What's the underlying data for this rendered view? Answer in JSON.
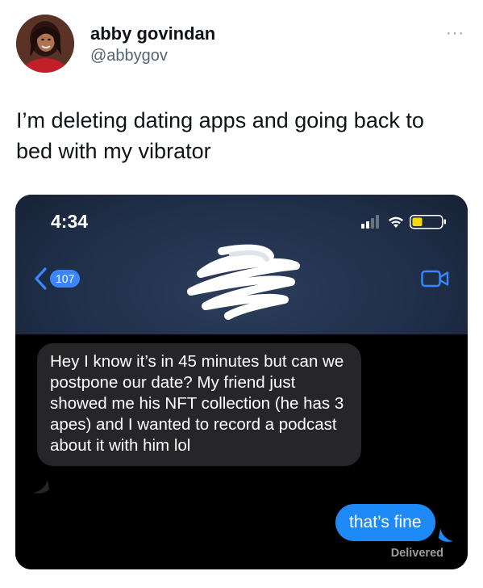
{
  "tweet": {
    "display_name": "abby govindan",
    "handle": "@abbygov",
    "more_label": "···",
    "text": "I’m deleting dating apps and going back to bed with my vibrator"
  },
  "screenshot": {
    "status_bar": {
      "time": "4:34"
    },
    "nav": {
      "unread_count": "107"
    },
    "messages": {
      "received": "Hey I know it’s in 45 minutes but can we postpone our date? My friend just showed me his NFT collection (he has 3 apes) and I wanted to record a podcast about it with him lol",
      "sent": "that’s fine",
      "delivery_status": "Delivered"
    },
    "colors": {
      "sent_bubble": "#1d8af8",
      "received_bubble": "#262629",
      "battery_level": "#f5d90a"
    },
    "icons": [
      "signal-icon",
      "wifi-icon",
      "battery-icon",
      "back-chevron-icon",
      "video-call-icon"
    ]
  }
}
